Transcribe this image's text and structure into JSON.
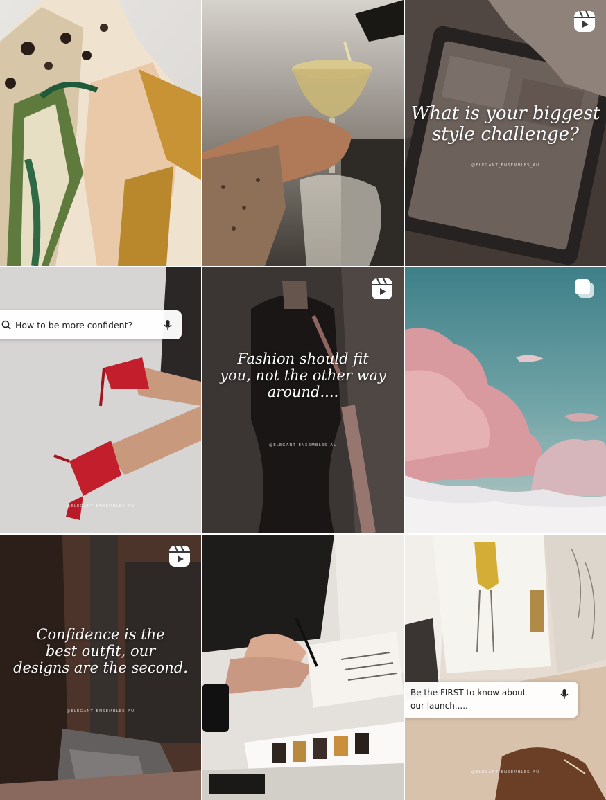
{
  "grid": {
    "posts": [
      {
        "id_label": "scarf-knot",
        "type_icon": "none",
        "quote": "",
        "handle": ""
      },
      {
        "id_label": "champagne-pour",
        "type_icon": "none",
        "quote": "",
        "handle": ""
      },
      {
        "id_label": "style-challenge",
        "type_icon": "reel-icon",
        "quote_lines": [
          "What is your biggest",
          "style challenge?"
        ],
        "handle": "@ELEGANT_ENSEMBLES_AU"
      },
      {
        "id_label": "red-heels",
        "type_icon": "none",
        "search_text": "How to be more confident?",
        "search_icon": "search-icon",
        "mic_icon": "microphone-icon",
        "handle": "@ELEGANT_ENSEMBLES_AU"
      },
      {
        "id_label": "dress-form",
        "type_icon": "reel-icon",
        "quote_lines": [
          "Fashion should fit",
          "you, not the other way",
          "around...."
        ],
        "handle": "@ELEGANT_ENSEMBLES_AU"
      },
      {
        "id_label": "pink-clouds",
        "type_icon": "carousel-icon",
        "quote": "",
        "handle": ""
      },
      {
        "id_label": "sewing-machine",
        "type_icon": "reel-icon",
        "quote_lines": [
          "Confidence is the",
          "best outfit, our",
          "designs are the second."
        ],
        "handle": "@ELEGANT_ENSEMBLES_AU"
      },
      {
        "id_label": "sketching-notebook",
        "type_icon": "none",
        "quote": "",
        "handle": ""
      },
      {
        "id_label": "fashion-sketches",
        "type_icon": "none",
        "search_lines": [
          "Be the FIRST to know about",
          "our launch....."
        ],
        "mic_icon": "microphone-icon",
        "handle": "@ELEGANT_ENSEMBLES_AU"
      }
    ]
  },
  "colors": {
    "overlay_text": "#ffffff",
    "search_bg": "#ffffff",
    "search_text": "#222222"
  }
}
